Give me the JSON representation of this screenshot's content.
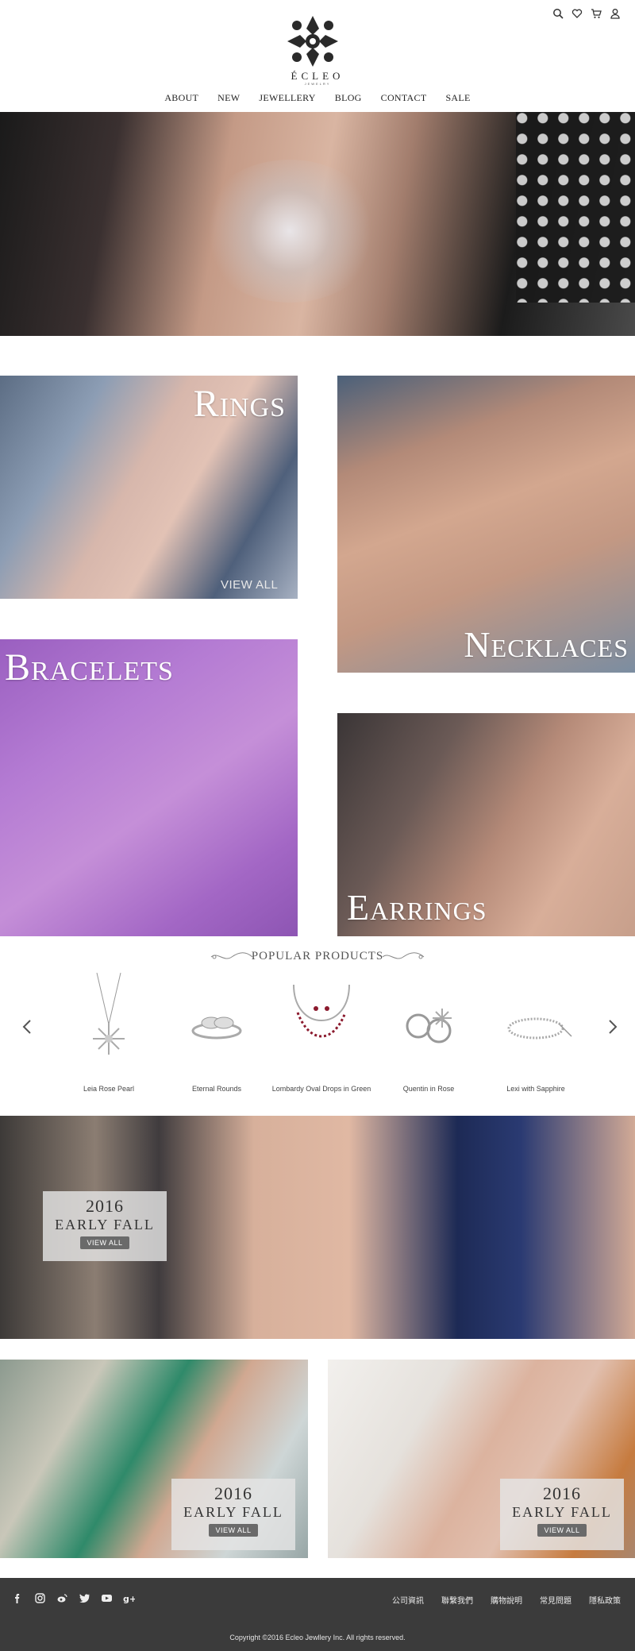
{
  "header": {
    "brand": "ÉCLEO",
    "brand_sub": "JEWELRY",
    "nav": [
      "ABOUT",
      "NEW",
      "JEWELLERY",
      "BLOG",
      "CONTACT",
      "SALE"
    ],
    "icons": [
      "search-icon",
      "heart-icon",
      "cart-icon",
      "user-icon"
    ]
  },
  "categories": {
    "rings": "Rings",
    "rings_viewall": "VIEW ALL",
    "necklaces": "Necklaces",
    "bracelets": "Bracelets",
    "earrings": "Earrings"
  },
  "popular": {
    "title": "POPULAR PRODUCTS",
    "prev_icon": "chevron-left-icon",
    "next_icon": "chevron-right-icon",
    "products": [
      {
        "name": "Leia Rose Pearl"
      },
      {
        "name": "Eternal Rounds"
      },
      {
        "name": "Lombardy Oval Drops in Green"
      },
      {
        "name": "Quentin in Rose"
      },
      {
        "name": "Lexi with Sapphire"
      }
    ]
  },
  "promos": {
    "main": {
      "year": "2016",
      "season": "EARLY FALL",
      "button": "VIEW ALL"
    },
    "left": {
      "year": "2016",
      "season": "EARLY FALL",
      "button": "VIEW ALL"
    },
    "right": {
      "year": "2016",
      "season": "EARLY FALL",
      "button": "VIEW ALL"
    }
  },
  "footer": {
    "social": [
      "facebook-icon",
      "instagram-icon",
      "weibo-icon",
      "twitter-icon",
      "youtube-icon",
      "google-plus-icon"
    ],
    "links": [
      "公司資訊",
      "聯繫我們",
      "購物說明",
      "常見問題",
      "隱私政策"
    ],
    "copyright": "Copyright ©2016 Ecleo Jewllery Inc. All rights reserved."
  },
  "colors": {
    "footer_bg": "#3b3b3b",
    "promo_button": "#6a6a6a",
    "text": "#333333"
  }
}
